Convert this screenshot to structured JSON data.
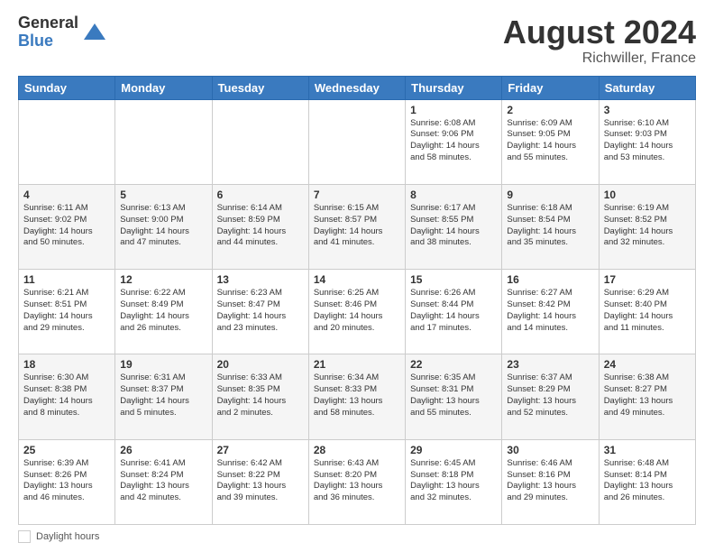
{
  "logo": {
    "general": "General",
    "blue": "Blue"
  },
  "title": "August 2024",
  "location": "Richwiller, France",
  "days_of_week": [
    "Sunday",
    "Monday",
    "Tuesday",
    "Wednesday",
    "Thursday",
    "Friday",
    "Saturday"
  ],
  "footer_label": "Daylight hours",
  "weeks": [
    [
      {
        "day": "",
        "info": ""
      },
      {
        "day": "",
        "info": ""
      },
      {
        "day": "",
        "info": ""
      },
      {
        "day": "",
        "info": ""
      },
      {
        "day": "1",
        "info": "Sunrise: 6:08 AM\nSunset: 9:06 PM\nDaylight: 14 hours\nand 58 minutes."
      },
      {
        "day": "2",
        "info": "Sunrise: 6:09 AM\nSunset: 9:05 PM\nDaylight: 14 hours\nand 55 minutes."
      },
      {
        "day": "3",
        "info": "Sunrise: 6:10 AM\nSunset: 9:03 PM\nDaylight: 14 hours\nand 53 minutes."
      }
    ],
    [
      {
        "day": "4",
        "info": "Sunrise: 6:11 AM\nSunset: 9:02 PM\nDaylight: 14 hours\nand 50 minutes."
      },
      {
        "day": "5",
        "info": "Sunrise: 6:13 AM\nSunset: 9:00 PM\nDaylight: 14 hours\nand 47 minutes."
      },
      {
        "day": "6",
        "info": "Sunrise: 6:14 AM\nSunset: 8:59 PM\nDaylight: 14 hours\nand 44 minutes."
      },
      {
        "day": "7",
        "info": "Sunrise: 6:15 AM\nSunset: 8:57 PM\nDaylight: 14 hours\nand 41 minutes."
      },
      {
        "day": "8",
        "info": "Sunrise: 6:17 AM\nSunset: 8:55 PM\nDaylight: 14 hours\nand 38 minutes."
      },
      {
        "day": "9",
        "info": "Sunrise: 6:18 AM\nSunset: 8:54 PM\nDaylight: 14 hours\nand 35 minutes."
      },
      {
        "day": "10",
        "info": "Sunrise: 6:19 AM\nSunset: 8:52 PM\nDaylight: 14 hours\nand 32 minutes."
      }
    ],
    [
      {
        "day": "11",
        "info": "Sunrise: 6:21 AM\nSunset: 8:51 PM\nDaylight: 14 hours\nand 29 minutes."
      },
      {
        "day": "12",
        "info": "Sunrise: 6:22 AM\nSunset: 8:49 PM\nDaylight: 14 hours\nand 26 minutes."
      },
      {
        "day": "13",
        "info": "Sunrise: 6:23 AM\nSunset: 8:47 PM\nDaylight: 14 hours\nand 23 minutes."
      },
      {
        "day": "14",
        "info": "Sunrise: 6:25 AM\nSunset: 8:46 PM\nDaylight: 14 hours\nand 20 minutes."
      },
      {
        "day": "15",
        "info": "Sunrise: 6:26 AM\nSunset: 8:44 PM\nDaylight: 14 hours\nand 17 minutes."
      },
      {
        "day": "16",
        "info": "Sunrise: 6:27 AM\nSunset: 8:42 PM\nDaylight: 14 hours\nand 14 minutes."
      },
      {
        "day": "17",
        "info": "Sunrise: 6:29 AM\nSunset: 8:40 PM\nDaylight: 14 hours\nand 11 minutes."
      }
    ],
    [
      {
        "day": "18",
        "info": "Sunrise: 6:30 AM\nSunset: 8:38 PM\nDaylight: 14 hours\nand 8 minutes."
      },
      {
        "day": "19",
        "info": "Sunrise: 6:31 AM\nSunset: 8:37 PM\nDaylight: 14 hours\nand 5 minutes."
      },
      {
        "day": "20",
        "info": "Sunrise: 6:33 AM\nSunset: 8:35 PM\nDaylight: 14 hours\nand 2 minutes."
      },
      {
        "day": "21",
        "info": "Sunrise: 6:34 AM\nSunset: 8:33 PM\nDaylight: 13 hours\nand 58 minutes."
      },
      {
        "day": "22",
        "info": "Sunrise: 6:35 AM\nSunset: 8:31 PM\nDaylight: 13 hours\nand 55 minutes."
      },
      {
        "day": "23",
        "info": "Sunrise: 6:37 AM\nSunset: 8:29 PM\nDaylight: 13 hours\nand 52 minutes."
      },
      {
        "day": "24",
        "info": "Sunrise: 6:38 AM\nSunset: 8:27 PM\nDaylight: 13 hours\nand 49 minutes."
      }
    ],
    [
      {
        "day": "25",
        "info": "Sunrise: 6:39 AM\nSunset: 8:26 PM\nDaylight: 13 hours\nand 46 minutes."
      },
      {
        "day": "26",
        "info": "Sunrise: 6:41 AM\nSunset: 8:24 PM\nDaylight: 13 hours\nand 42 minutes."
      },
      {
        "day": "27",
        "info": "Sunrise: 6:42 AM\nSunset: 8:22 PM\nDaylight: 13 hours\nand 39 minutes."
      },
      {
        "day": "28",
        "info": "Sunrise: 6:43 AM\nSunset: 8:20 PM\nDaylight: 13 hours\nand 36 minutes."
      },
      {
        "day": "29",
        "info": "Sunrise: 6:45 AM\nSunset: 8:18 PM\nDaylight: 13 hours\nand 32 minutes."
      },
      {
        "day": "30",
        "info": "Sunrise: 6:46 AM\nSunset: 8:16 PM\nDaylight: 13 hours\nand 29 minutes."
      },
      {
        "day": "31",
        "info": "Sunrise: 6:48 AM\nSunset: 8:14 PM\nDaylight: 13 hours\nand 26 minutes."
      }
    ]
  ]
}
